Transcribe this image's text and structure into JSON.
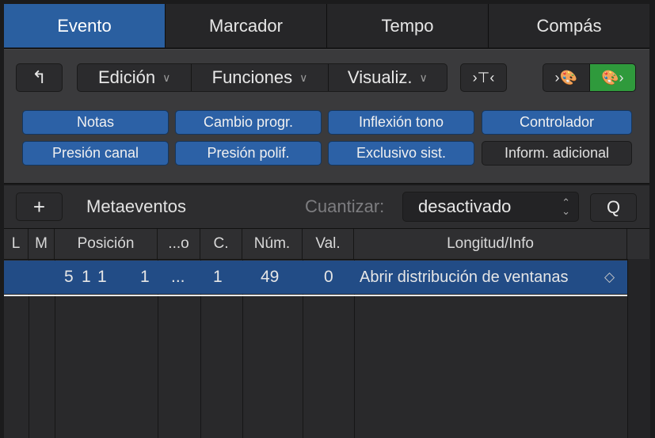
{
  "tabs": [
    "Evento",
    "Marcador",
    "Tempo",
    "Compás"
  ],
  "toolbar": {
    "back_glyph": "↰",
    "menus": [
      "Edición",
      "Funciones",
      "Visualiz."
    ],
    "chevron": "∨",
    "filter_glyph": "›⊤‹",
    "left_palette_glyph": "›🎨",
    "right_palette_glyph": "🎨›"
  },
  "filters": {
    "row1": [
      "Notas",
      "Cambio progr.",
      "Inflexión tono",
      "Controlador"
    ],
    "row2": [
      "Presión canal",
      "Presión polif.",
      "Exclusivo sist.",
      "Inform. adicional"
    ]
  },
  "meta": {
    "add_glyph": "+",
    "label": "Metaeventos",
    "quantize_label": "Cuantizar:",
    "quantize_value": "desactivado",
    "q_button": "Q",
    "updown_glyph": "⌃⌄"
  },
  "table": {
    "headers": [
      "L",
      "M",
      "Posición",
      "...o",
      "C.",
      "Núm.",
      "Val.",
      "Longitud/Info"
    ],
    "row": {
      "pos_1": "5",
      "pos_2": "1",
      "pos_3": "1",
      "pos_4": "1",
      "ellipsis": "...",
      "channel": "1",
      "number": "49",
      "value": "0",
      "info": "Abrir distribución de ventanas",
      "info_icon": "◇"
    }
  },
  "colors": {
    "accent_blue": "#2c61a6",
    "active_tab": "#2a5fa0",
    "selected_row": "#224c86",
    "green_toggle": "#2f9a3c"
  }
}
